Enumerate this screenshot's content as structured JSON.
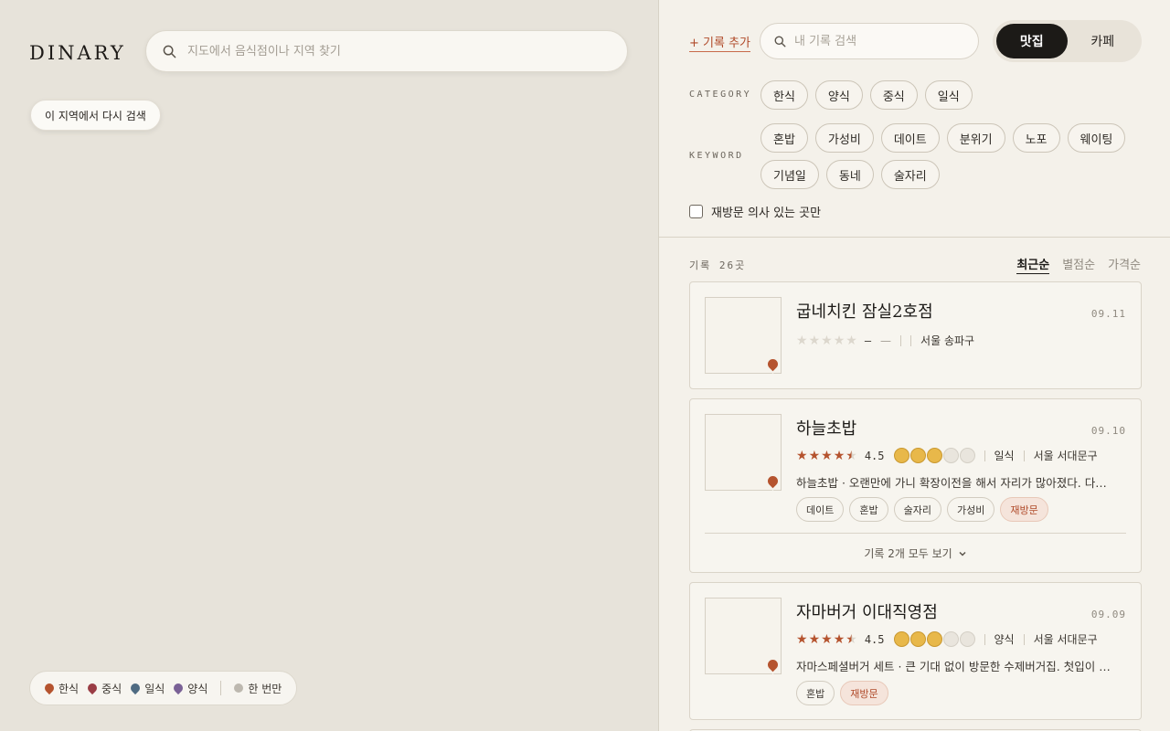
{
  "map": {
    "logo": "DINARY",
    "search_placeholder": "지도에서 음식점이나 지역 찾기",
    "research_label": "이 지역에서 다시 검색",
    "legend": [
      {
        "label": "한식",
        "color": "#b5532e"
      },
      {
        "label": "중식",
        "color": "#9a3d45"
      },
      {
        "label": "일식",
        "color": "#4f6b82"
      },
      {
        "label": "양식",
        "color": "#7a6196"
      }
    ],
    "legend_once": "한 번만"
  },
  "panel": {
    "add_record": "+ 기록 추가",
    "search_placeholder": "내 기록 검색",
    "segments": [
      {
        "label": "맛집",
        "active": true
      },
      {
        "label": "카페",
        "active": false
      }
    ],
    "category_label": "CATEGORY",
    "categories": [
      "한식",
      "양식",
      "중식",
      "일식"
    ],
    "keyword_label": "KEYWORD",
    "keywords": [
      "혼밥",
      "가성비",
      "데이트",
      "분위기",
      "노포",
      "웨이팅",
      "기념일",
      "동네",
      "술자리"
    ],
    "revisit_only": "재방문 의사 있는 곳만",
    "count_text": "기록 26곳",
    "sorts": [
      {
        "label": "최근순",
        "active": true
      },
      {
        "label": "별점순",
        "active": false
      },
      {
        "label": "가격순",
        "active": false
      }
    ],
    "accent_color": "#b5532e"
  },
  "records": [
    {
      "name": "굽네치킨 잠실2호점",
      "date": "09.11",
      "rating": null,
      "rating_text": "—",
      "price_level": null,
      "price_text": "—",
      "category": "",
      "region": "서울 송파구",
      "description": "",
      "tags": [],
      "expand": ""
    },
    {
      "name": "하늘초밥",
      "date": "09.10",
      "rating": 4.5,
      "rating_text": "4.5",
      "price_level": 3,
      "category": "일식",
      "region": "서울 서대문구",
      "description": "하늘초밥 · 오랜만에 가니 확장이전을 해서 자리가 많아졌다. 다…",
      "tags": [
        "데이트",
        "혼밥",
        "술자리",
        "가성비"
      ],
      "revisit_tag": "재방문",
      "expand": "기록 2개 모두 보기"
    },
    {
      "name": "자마버거 이대직영점",
      "date": "09.09",
      "rating": 4.5,
      "rating_text": "4.5",
      "price_level": 3,
      "category": "양식",
      "region": "서울 서대문구",
      "description": "자마스페셜버거 세트 · 큰 기대 없이 방문한 수제버거집. 첫입이 …",
      "tags": [
        "혼밥"
      ],
      "revisit_tag": "재방문",
      "expand": ""
    }
  ]
}
